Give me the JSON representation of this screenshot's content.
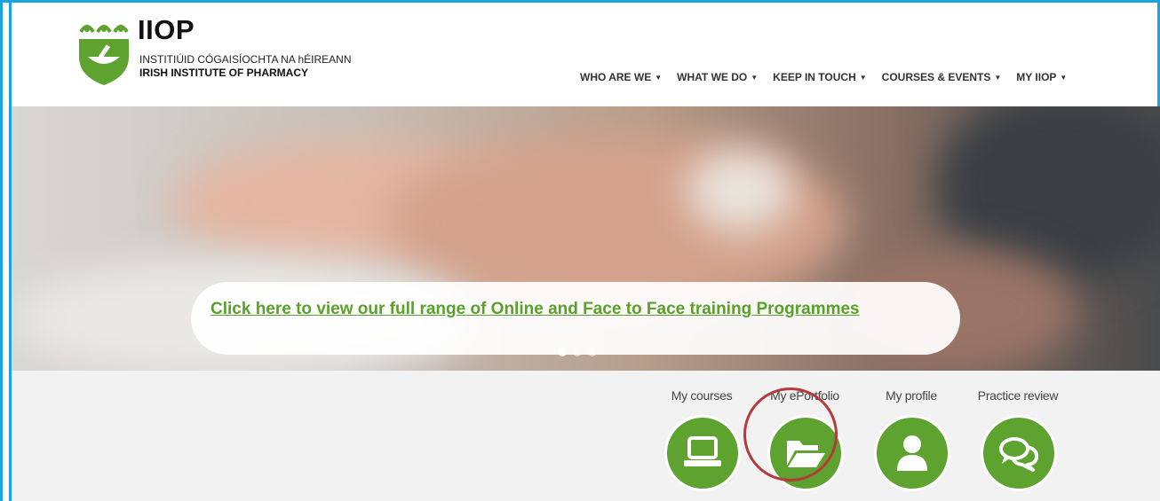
{
  "brand": {
    "acronym": "IIOP",
    "irish_name": "INSTITIÚID CÓGAISÍOCHTA NA hÉIREANN",
    "english_name": "IRISH INSTITUTE OF PHARMACY",
    "color": "#5ea22f"
  },
  "nav": {
    "items": [
      {
        "label": "WHO ARE WE"
      },
      {
        "label": "WHAT WE DO"
      },
      {
        "label": "KEEP IN TOUCH"
      },
      {
        "label": "COURSES & EVENTS"
      },
      {
        "label": "MY IIOP"
      }
    ],
    "caret": "▼"
  },
  "hero": {
    "cta_text": "Click here to view our full range of Online and Face to Face training Programmes",
    "slides_total": 3,
    "active_slide": 1
  },
  "quick_links": [
    {
      "label": "My courses",
      "icon": "laptop-icon"
    },
    {
      "label": "My ePortfolio",
      "icon": "folder-open-icon",
      "highlighted": true
    },
    {
      "label": "My profile",
      "icon": "user-icon"
    },
    {
      "label": "Practice review",
      "icon": "chat-bubbles-icon"
    }
  ],
  "colors": {
    "frame": "#1aa3e2",
    "cta_link": "#5aa02c",
    "highlight_ring": "#b63a3a"
  }
}
